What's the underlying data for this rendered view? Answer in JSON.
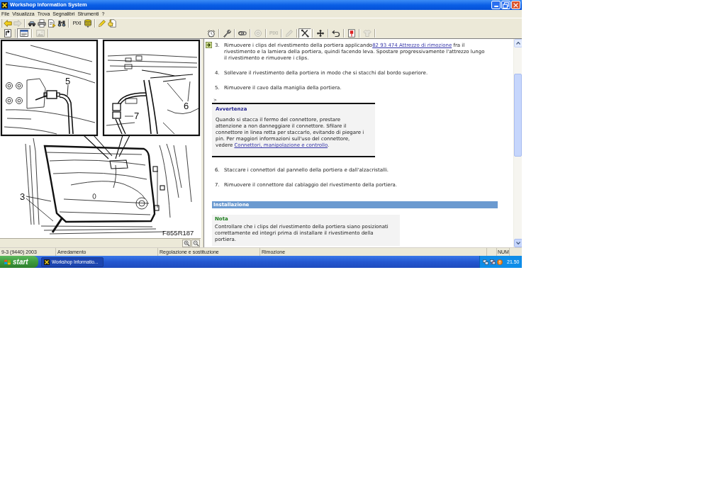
{
  "window": {
    "title": "Workshop Information System"
  },
  "menu": [
    "File",
    "Visualizza",
    "Trova",
    "Segnalibri",
    "Strumenti",
    "?"
  ],
  "main_toolbar": {
    "groups": [
      [
        {
          "kind": "icon",
          "disabled": false
        },
        {
          "kind": "icon",
          "disabled": true
        }
      ],
      [
        {
          "kind": "icon",
          "disabled": false
        },
        {
          "kind": "icon",
          "disabled": false
        },
        {
          "kind": "icon",
          "disabled": false
        },
        {
          "kind": "icon",
          "disabled": false
        }
      ],
      [
        {
          "kind": "text",
          "label": "PIXI",
          "disabled": false
        },
        {
          "kind": "icon",
          "disabled": false
        }
      ],
      [
        {
          "kind": "icon",
          "disabled": false
        },
        {
          "kind": "icon",
          "disabled": false
        }
      ]
    ]
  },
  "figure_toolbar": [
    {
      "disabled": false,
      "selected": false
    },
    {
      "disabled": false,
      "selected": true
    },
    {
      "disabled": true,
      "selected": false
    }
  ],
  "document_toolbar": [
    {
      "kind": "icon",
      "disabled": false,
      "selected": false
    },
    {
      "kind": "icon",
      "disabled": false,
      "selected": false
    },
    {
      "kind": "icon",
      "disabled": false,
      "selected": false
    },
    {
      "kind": "icon",
      "disabled": true,
      "selected": false
    },
    {
      "kind": "text",
      "label": "PIXI",
      "disabled": true,
      "selected": false
    },
    {
      "kind": "icon",
      "disabled": true,
      "selected": false
    },
    {
      "kind": "icon",
      "disabled": false,
      "selected": true
    },
    {
      "kind": "icon",
      "disabled": false,
      "selected": false
    },
    {
      "kind": "icon",
      "disabled": false,
      "selected": false
    },
    {
      "kind": "icon",
      "disabled": false,
      "selected": false
    },
    {
      "kind": "icon",
      "disabled": true,
      "selected": false
    }
  ],
  "figure": {
    "callouts": [
      "5",
      "6",
      "7",
      "3"
    ],
    "code": "F855R187"
  },
  "document": {
    "blocks": [
      {
        "kind": "step",
        "number": "3.",
        "text": "Rimuovere i clips del rivestimento della portiera applicando",
        "link": "82 93 474 Attrezzo di rimozione",
        "text_after": " fra il rivestimento e la lamiera della portiera, quindi facendo leva. Spostare progressivamente l'attrezzo lungo il rivestimento e rimuovere i clips."
      },
      {
        "kind": "step",
        "number": "4.",
        "text": "Sollevare il rivestimento della portiera in modo che si stacchi dal bordo superiore."
      },
      {
        "kind": "step",
        "number": "5.",
        "text": "Rimuovere il cavo dalla maniglia della portiera."
      },
      {
        "kind": "warning",
        "prefix": ">",
        "title": "Avvertenza",
        "text": "Quando si stacca il fermo del connettore, prestare attenzione a non danneggiare il connettore. Sfilare il connettore in linea retta per staccarlo, evitando di piegare i pin. Per maggiori informazioni sull'uso del connettore, vedere ",
        "link": "Connettori, manipolazione e controllo",
        "text_after": "."
      },
      {
        "kind": "step",
        "number": "6.",
        "text": "Staccare i connettori dal pannello della portiera e dall'alzacristalli."
      },
      {
        "kind": "step",
        "number": "7.",
        "text": "Rimuovere il connettore dal cablaggio del rivestimento della portiera."
      },
      {
        "kind": "heading",
        "text": "Installazione"
      },
      {
        "kind": "note",
        "title": "Nota",
        "text": "Controllare che i clips del rivestimento della portiera siano posizionati correttamente ed integri prima di installare il rivestimento della portiera."
      }
    ]
  },
  "status_bar": {
    "panes": [
      "9-3 (9440) 2003",
      "Arredamento",
      "Regolazione e sostituzione",
      "Rimozione"
    ],
    "indicators": [
      "NUM"
    ]
  },
  "taskbar": {
    "start": "start",
    "tasks": [
      {
        "label": "Workshop Informatio...",
        "selected": true
      }
    ],
    "clock": "21.50"
  }
}
